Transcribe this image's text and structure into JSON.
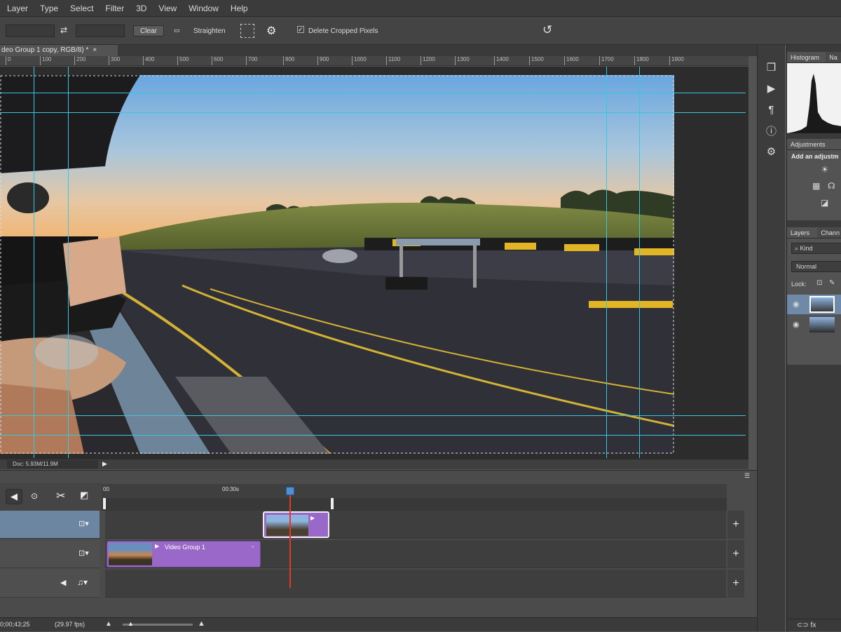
{
  "menu": [
    "Layer",
    "Type",
    "Select",
    "Filter",
    "3D",
    "View",
    "Window",
    "Help"
  ],
  "options": {
    "clear_label": "Clear",
    "straighten_label": "Straighten",
    "delete_cropped_label": "Delete Cropped Pixels",
    "delete_cropped_checked": true
  },
  "document_tab": "deo Group 1 copy, RGB/8) *",
  "ruler_ticks": [
    "0",
    "100",
    "200",
    "300",
    "400",
    "500",
    "600",
    "700",
    "800",
    "900",
    "1000",
    "1100",
    "1200",
    "1300",
    "1400",
    "1500",
    "1600",
    "1700",
    "1800",
    "1900"
  ],
  "status": {
    "doc_size": "Doc: 5.93M/11.9M"
  },
  "right_panels": {
    "histogram_tab": "Histogram",
    "navigator_tab": "Na",
    "adjustments_tab": "Adjustments",
    "adjustments_hint": "Add an adjustm",
    "layers_tab": "Layers",
    "channels_tab": "Chann",
    "kind_label": "Kind",
    "blend_mode": "Normal",
    "lock_label": "Lock:"
  },
  "timeline": {
    "timecode_start": "00",
    "timecode_mid": "00:30s",
    "clip1_label": "Video Group 1",
    "current_time": "0;00;43;25",
    "fps": "(29.97 fps)"
  },
  "colors": {
    "guide": "#36c8e0",
    "clip": "#9a68c9",
    "playhead": "#e3392b"
  }
}
